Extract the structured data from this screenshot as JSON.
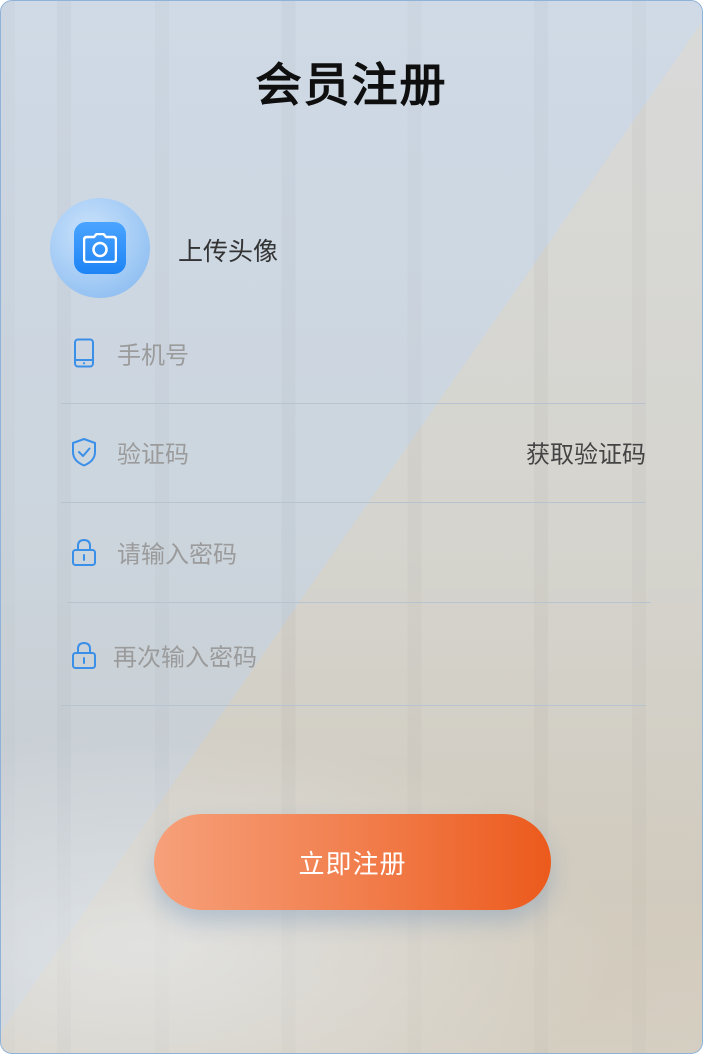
{
  "title": "会员注册",
  "avatar": {
    "label": "上传头像",
    "icon": "camera-icon"
  },
  "form": {
    "phone": {
      "placeholder": "手机号",
      "icon": "phone-icon"
    },
    "code": {
      "placeholder": "验证码",
      "icon": "shield-icon",
      "get_code_label": "获取验证码"
    },
    "password": {
      "placeholder": "请输入密码",
      "icon": "lock-icon"
    },
    "confirm_password": {
      "placeholder": "再次输入密码",
      "icon": "lock-icon"
    }
  },
  "submit_label": "立即注册",
  "colors": {
    "accent_blue": "#1e84f5",
    "button_start": "#f6a07a",
    "button_end": "#ec5a1c",
    "divider": "#b7c3cf"
  }
}
